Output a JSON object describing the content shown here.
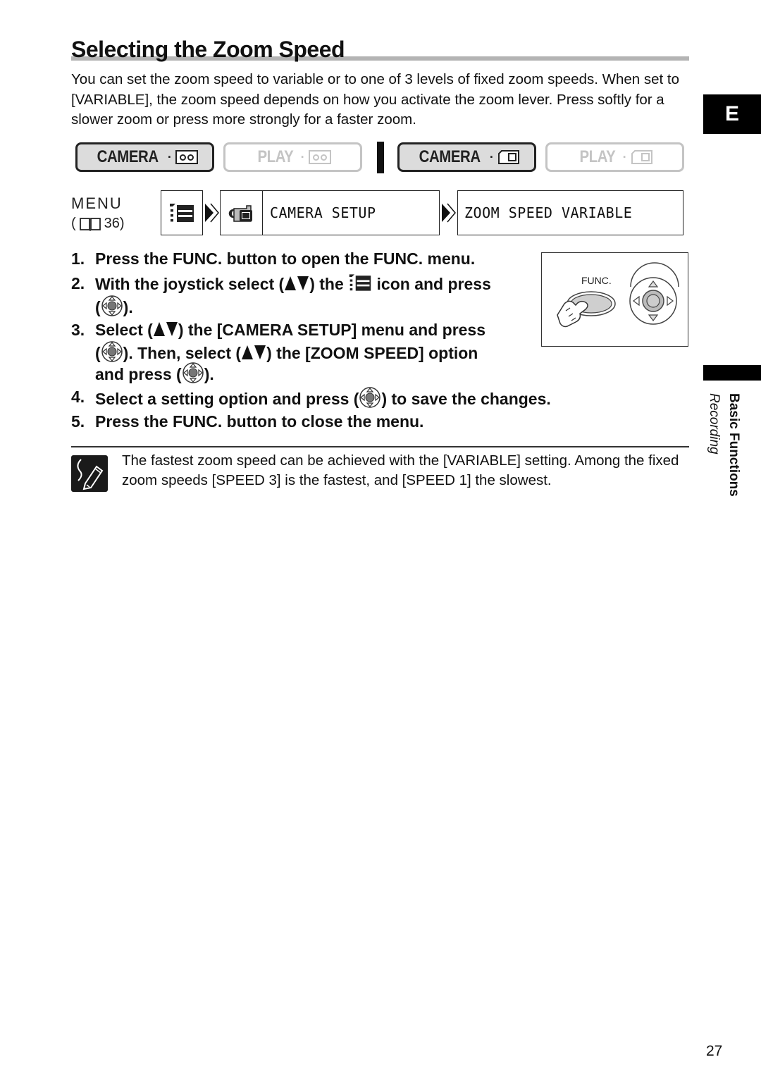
{
  "header": {
    "title": "Selecting the Zoom Speed",
    "intro": "You can set the zoom speed to variable or to one of 3 levels of fixed zoom speeds. When set to [VARIABLE], the zoom speed depends on how you activate the zoom lever. Press softly for a slower zoom or press more strongly for a faster zoom."
  },
  "modes": [
    {
      "label": "CAMERA",
      "media": "tape-icon",
      "active": true
    },
    {
      "label": "PLAY",
      "media": "tape-icon",
      "active": false
    },
    {
      "label": "CAMERA",
      "media": "memory-card-icon",
      "active": true
    },
    {
      "label": "PLAY",
      "media": "memory-card-icon",
      "active": false
    }
  ],
  "menu": {
    "label": "MENU",
    "ref_open": "(",
    "ref_page": "36)",
    "path": [
      {
        "icon": "menu-list-icon"
      },
      {
        "icon": "camera-setup-icon",
        "label": "CAMERA SETUP"
      },
      {
        "label": "ZOOM SPEED VARIABLE"
      }
    ]
  },
  "steps": [
    {
      "num": "1.",
      "lines": [
        "Press the FUNC. button to open the FUNC. menu."
      ]
    },
    {
      "num": "2.",
      "parts": {
        "a": "With the joystick select (",
        "b": ") the",
        "c": "icon and press",
        "d": "(",
        "e": ")."
      }
    },
    {
      "num": "3.",
      "parts": {
        "l1a": "Select (",
        "l1b": ") the [CAMERA SETUP] menu and press",
        "l2a": "(",
        "l2b": "). Then, select (",
        "l2c": ") the [ZOOM SPEED] option",
        "l3a": "and press (",
        "l3b": ")."
      }
    },
    {
      "num": "4.",
      "parts": {
        "a": "Select a setting option and press (",
        "b": ") to save the changes."
      }
    },
    {
      "num": "5.",
      "lines": [
        "Press the FUNC. button to close the menu."
      ]
    }
  ],
  "illustration": {
    "func_label": "FUNC."
  },
  "note": {
    "icon": "pencil-note-icon",
    "text": "The fastest zoom speed can be achieved with the [VARIABLE] setting. Among the fixed zoom speeds [SPEED 3] is the fastest, and [SPEED 1] the slowest."
  },
  "side": {
    "language_tab": "E",
    "section": "Basic Functions",
    "subsection": "Recording"
  },
  "footer": {
    "page_number": "27"
  }
}
